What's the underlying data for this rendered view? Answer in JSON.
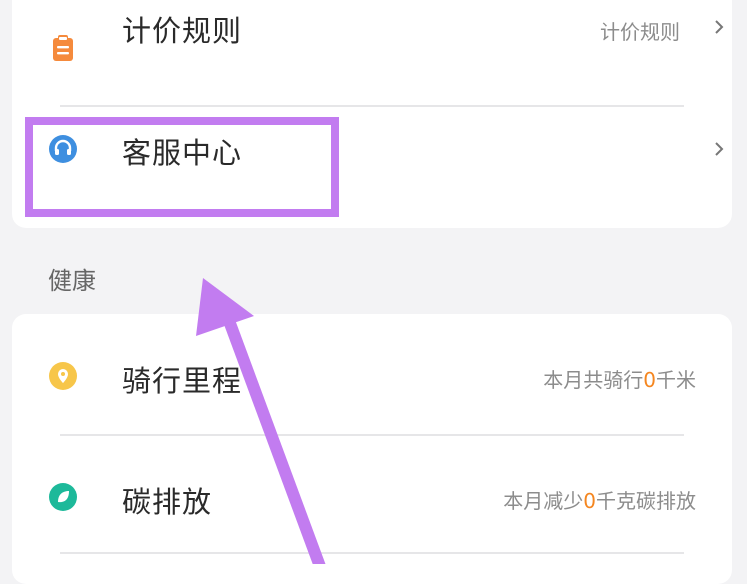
{
  "settings": {
    "pricing": {
      "title": "计价规则",
      "value": "计价规则"
    },
    "service": {
      "title": "客服中心"
    }
  },
  "health": {
    "section_title": "健康",
    "mileage": {
      "title": "骑行里程",
      "prefix": "本月共骑行",
      "value": "0",
      "suffix": "千米"
    },
    "carbon": {
      "title": "碳排放",
      "prefix": "本月减少",
      "value": "0",
      "suffix": "千克碳排放"
    }
  },
  "colors": {
    "pricing_icon": "#f58a3c",
    "service_icon": "#3e8fe0",
    "mileage_icon": "#f7c64a",
    "carbon_icon": "#1db99a",
    "highlight_value": "#f5861f",
    "annotation": "#c27cf0"
  },
  "icons": {
    "pricing": "clipboard-icon",
    "service": "headset-icon",
    "mileage": "location-pin-icon",
    "carbon": "leaf-icon",
    "chevron": "chevron-right-icon",
    "arrow": "arrow-up-annotation"
  }
}
